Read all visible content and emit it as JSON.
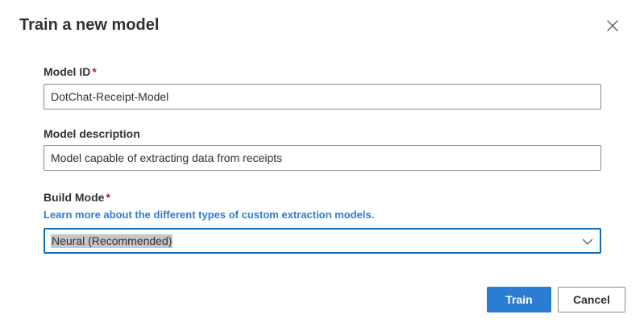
{
  "dialog": {
    "title": "Train a new model",
    "close_icon": "close-icon"
  },
  "fields": {
    "model_id": {
      "label": "Model ID",
      "required_marker": "*",
      "value": "DotChat-Receipt-Model"
    },
    "model_description": {
      "label": "Model description",
      "value": "Model capable of extracting data from receipts"
    },
    "build_mode": {
      "label": "Build Mode",
      "required_marker": "*",
      "link_text": "Learn more about the different types of custom extraction models.",
      "selected_value": "Neural (Recommended)",
      "chevron_icon": "chevron-down-icon"
    }
  },
  "actions": {
    "train_label": "Train",
    "cancel_label": "Cancel"
  },
  "colors": {
    "primary": "#2b7cd3",
    "required": "#a4262c",
    "focus_border": "#0f6cbd",
    "text": "#323130",
    "border": "#8a8886"
  }
}
